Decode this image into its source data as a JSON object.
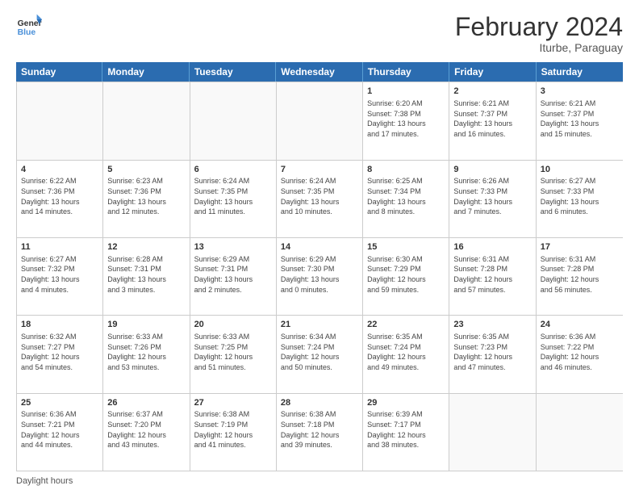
{
  "header": {
    "title": "February 2024",
    "subtitle": "Iturbe, Paraguay",
    "logo_line1": "General",
    "logo_line2": "Blue"
  },
  "days_of_week": [
    "Sunday",
    "Monday",
    "Tuesday",
    "Wednesday",
    "Thursday",
    "Friday",
    "Saturday"
  ],
  "footer_label": "Daylight hours",
  "weeks": [
    [
      {
        "day": "",
        "info": ""
      },
      {
        "day": "",
        "info": ""
      },
      {
        "day": "",
        "info": ""
      },
      {
        "day": "",
        "info": ""
      },
      {
        "day": "1",
        "info": "Sunrise: 6:20 AM\nSunset: 7:38 PM\nDaylight: 13 hours\nand 17 minutes."
      },
      {
        "day": "2",
        "info": "Sunrise: 6:21 AM\nSunset: 7:37 PM\nDaylight: 13 hours\nand 16 minutes."
      },
      {
        "day": "3",
        "info": "Sunrise: 6:21 AM\nSunset: 7:37 PM\nDaylight: 13 hours\nand 15 minutes."
      }
    ],
    [
      {
        "day": "4",
        "info": "Sunrise: 6:22 AM\nSunset: 7:36 PM\nDaylight: 13 hours\nand 14 minutes."
      },
      {
        "day": "5",
        "info": "Sunrise: 6:23 AM\nSunset: 7:36 PM\nDaylight: 13 hours\nand 12 minutes."
      },
      {
        "day": "6",
        "info": "Sunrise: 6:24 AM\nSunset: 7:35 PM\nDaylight: 13 hours\nand 11 minutes."
      },
      {
        "day": "7",
        "info": "Sunrise: 6:24 AM\nSunset: 7:35 PM\nDaylight: 13 hours\nand 10 minutes."
      },
      {
        "day": "8",
        "info": "Sunrise: 6:25 AM\nSunset: 7:34 PM\nDaylight: 13 hours\nand 8 minutes."
      },
      {
        "day": "9",
        "info": "Sunrise: 6:26 AM\nSunset: 7:33 PM\nDaylight: 13 hours\nand 7 minutes."
      },
      {
        "day": "10",
        "info": "Sunrise: 6:27 AM\nSunset: 7:33 PM\nDaylight: 13 hours\nand 6 minutes."
      }
    ],
    [
      {
        "day": "11",
        "info": "Sunrise: 6:27 AM\nSunset: 7:32 PM\nDaylight: 13 hours\nand 4 minutes."
      },
      {
        "day": "12",
        "info": "Sunrise: 6:28 AM\nSunset: 7:31 PM\nDaylight: 13 hours\nand 3 minutes."
      },
      {
        "day": "13",
        "info": "Sunrise: 6:29 AM\nSunset: 7:31 PM\nDaylight: 13 hours\nand 2 minutes."
      },
      {
        "day": "14",
        "info": "Sunrise: 6:29 AM\nSunset: 7:30 PM\nDaylight: 13 hours\nand 0 minutes."
      },
      {
        "day": "15",
        "info": "Sunrise: 6:30 AM\nSunset: 7:29 PM\nDaylight: 12 hours\nand 59 minutes."
      },
      {
        "day": "16",
        "info": "Sunrise: 6:31 AM\nSunset: 7:28 PM\nDaylight: 12 hours\nand 57 minutes."
      },
      {
        "day": "17",
        "info": "Sunrise: 6:31 AM\nSunset: 7:28 PM\nDaylight: 12 hours\nand 56 minutes."
      }
    ],
    [
      {
        "day": "18",
        "info": "Sunrise: 6:32 AM\nSunset: 7:27 PM\nDaylight: 12 hours\nand 54 minutes."
      },
      {
        "day": "19",
        "info": "Sunrise: 6:33 AM\nSunset: 7:26 PM\nDaylight: 12 hours\nand 53 minutes."
      },
      {
        "day": "20",
        "info": "Sunrise: 6:33 AM\nSunset: 7:25 PM\nDaylight: 12 hours\nand 51 minutes."
      },
      {
        "day": "21",
        "info": "Sunrise: 6:34 AM\nSunset: 7:24 PM\nDaylight: 12 hours\nand 50 minutes."
      },
      {
        "day": "22",
        "info": "Sunrise: 6:35 AM\nSunset: 7:24 PM\nDaylight: 12 hours\nand 49 minutes."
      },
      {
        "day": "23",
        "info": "Sunrise: 6:35 AM\nSunset: 7:23 PM\nDaylight: 12 hours\nand 47 minutes."
      },
      {
        "day": "24",
        "info": "Sunrise: 6:36 AM\nSunset: 7:22 PM\nDaylight: 12 hours\nand 46 minutes."
      }
    ],
    [
      {
        "day": "25",
        "info": "Sunrise: 6:36 AM\nSunset: 7:21 PM\nDaylight: 12 hours\nand 44 minutes."
      },
      {
        "day": "26",
        "info": "Sunrise: 6:37 AM\nSunset: 7:20 PM\nDaylight: 12 hours\nand 43 minutes."
      },
      {
        "day": "27",
        "info": "Sunrise: 6:38 AM\nSunset: 7:19 PM\nDaylight: 12 hours\nand 41 minutes."
      },
      {
        "day": "28",
        "info": "Sunrise: 6:38 AM\nSunset: 7:18 PM\nDaylight: 12 hours\nand 39 minutes."
      },
      {
        "day": "29",
        "info": "Sunrise: 6:39 AM\nSunset: 7:17 PM\nDaylight: 12 hours\nand 38 minutes."
      },
      {
        "day": "",
        "info": ""
      },
      {
        "day": "",
        "info": ""
      }
    ]
  ]
}
